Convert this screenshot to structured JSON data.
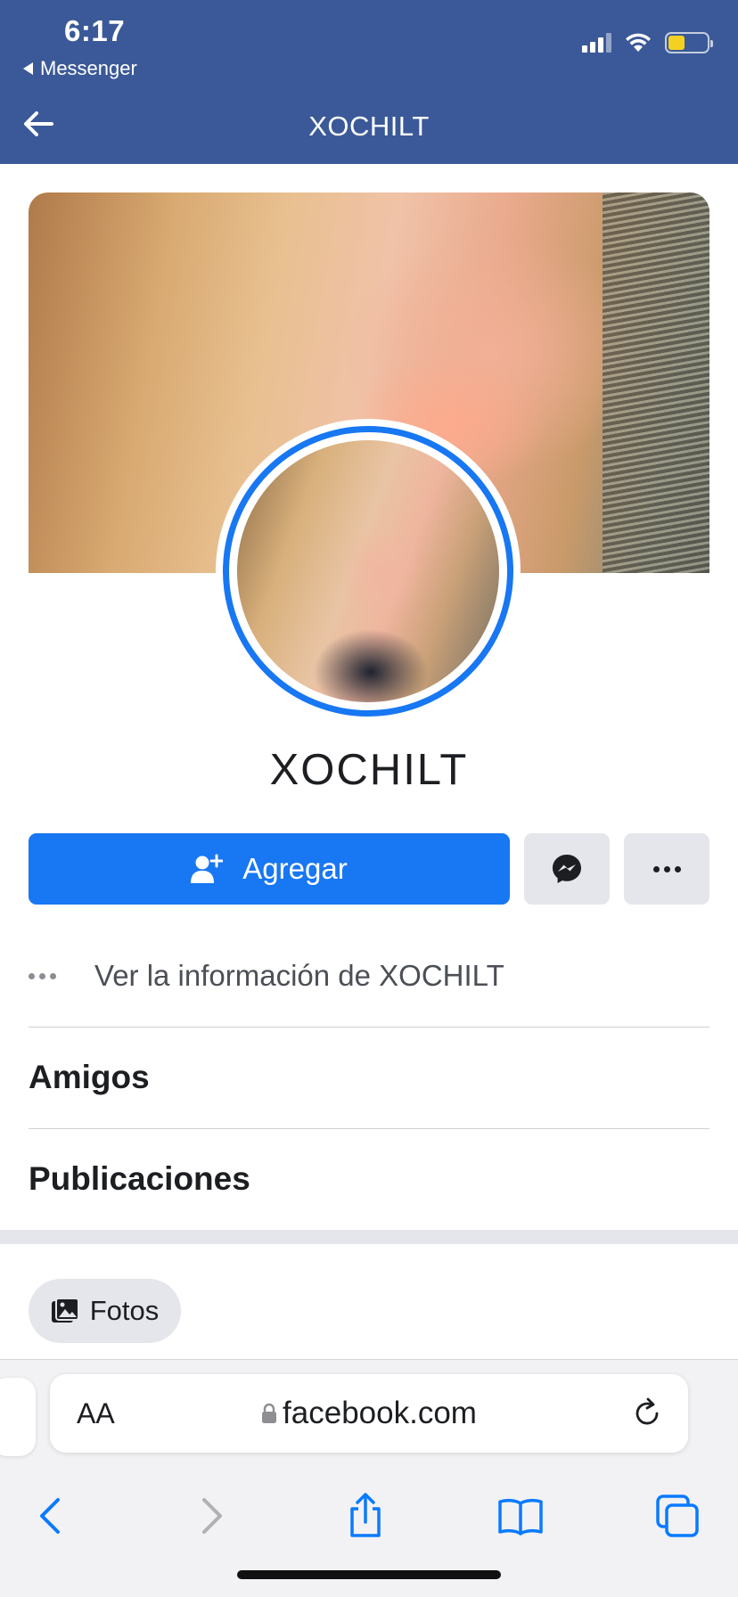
{
  "status_bar": {
    "time": "6:17",
    "back_app": "Messenger"
  },
  "header": {
    "title": "XOCHILT"
  },
  "profile": {
    "name": "XOCHILT"
  },
  "actions": {
    "add_label": "Agregar"
  },
  "info": {
    "see_info": "Ver la información de XOCHILT"
  },
  "sections": {
    "friends": "Amigos",
    "posts": "Publicaciones"
  },
  "photos_chip": {
    "label": "Fotos"
  },
  "browser": {
    "text_size": "AA",
    "url": "facebook.com"
  },
  "colors": {
    "brand": "#3b5998",
    "accent": "#1877f2",
    "button_gray": "#e4e6eb",
    "safari_blue": "#0a7aff"
  }
}
